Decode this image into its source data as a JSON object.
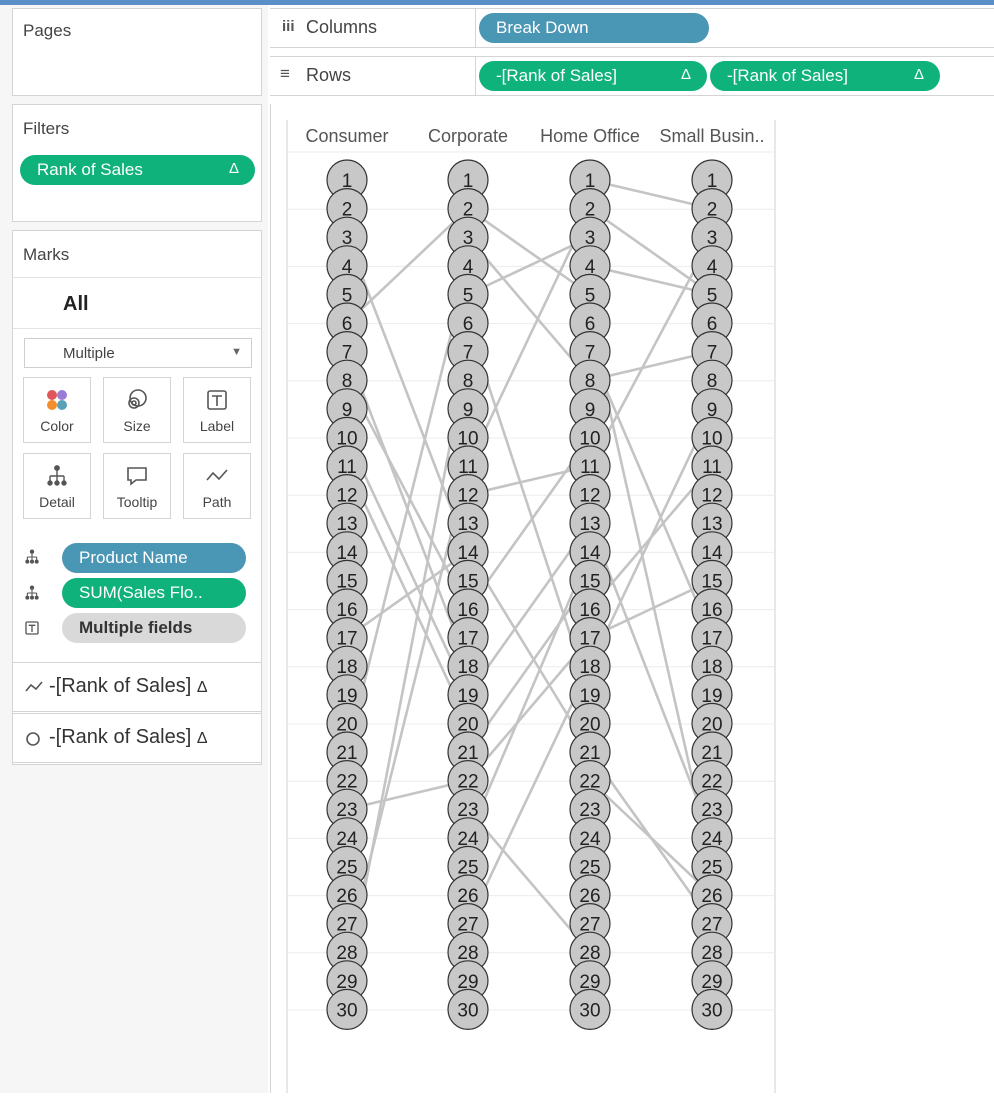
{
  "pages": {
    "title": "Pages"
  },
  "columns": {
    "label": "Columns",
    "pill": "Break Down"
  },
  "rows": {
    "label": "Rows",
    "pills": [
      "-[Rank of Sales]",
      "-[Rank of Sales]"
    ],
    "delta": "Δ"
  },
  "filters": {
    "title": "Filters",
    "pill": "Rank of Sales",
    "delta": "Δ"
  },
  "marks": {
    "title": "Marks",
    "all_label": "All",
    "mark_type": "Multiple",
    "buttons": [
      {
        "label": "Color",
        "icon": "color-icon"
      },
      {
        "label": "Size",
        "icon": "size-icon"
      },
      {
        "label": "Label",
        "icon": "label-icon"
      },
      {
        "label": "Detail",
        "icon": "detail-icon"
      },
      {
        "label": "Tooltip",
        "icon": "tooltip-icon"
      },
      {
        "label": "Path",
        "icon": "path-icon"
      }
    ],
    "fields": [
      {
        "label": "Product Name",
        "icon": "detail-icon"
      },
      {
        "label": "SUM(Sales Flo..",
        "icon": "detail-icon"
      },
      {
        "label": "Multiple fields",
        "icon": "label-icon"
      }
    ],
    "layers": [
      {
        "label": "-[Rank of Sales]",
        "icon": "line-mark-icon",
        "delta": "Δ"
      },
      {
        "label": "-[Rank of Sales]",
        "icon": "circle-mark-icon",
        "delta": "Δ"
      }
    ]
  },
  "colors": {
    "green": "#0fb27a",
    "blue": "#4a96b5",
    "node_fill": "#c8c8c8",
    "line": "#c4c4c4"
  },
  "chart_data": {
    "type": "bump",
    "categories": [
      "Consumer",
      "Corporate",
      "Home Office",
      "Small Busin.."
    ],
    "ranks": [
      1,
      2,
      3,
      4,
      5,
      6,
      7,
      8,
      9,
      10,
      11,
      12,
      13,
      14,
      15,
      16,
      17,
      18,
      19,
      20,
      21,
      22,
      23,
      24,
      25,
      26,
      27,
      28,
      29,
      30
    ],
    "y_reversed": true,
    "connections": [
      {
        "segment": "Consumer-Corporate",
        "from_rank": 6,
        "to_rank": 2
      },
      {
        "segment": "Consumer-Corporate",
        "from_rank": 3,
        "to_rank": 14
      },
      {
        "segment": "Consumer-Corporate",
        "from_rank": 7,
        "to_rank": 18
      },
      {
        "segment": "Consumer-Corporate",
        "from_rank": 8,
        "to_rank": 16
      },
      {
        "segment": "Consumer-Corporate",
        "from_rank": 10,
        "to_rank": 19
      },
      {
        "segment": "Consumer-Corporate",
        "from_rank": 11,
        "to_rank": 20
      },
      {
        "segment": "Consumer-Corporate",
        "from_rank": 17,
        "to_rank": 14
      },
      {
        "segment": "Consumer-Corporate",
        "from_rank": 21,
        "to_rank": 4
      },
      {
        "segment": "Consumer-Corporate",
        "from_rank": 23,
        "to_rank": 22
      },
      {
        "segment": "Consumer-Corporate",
        "from_rank": 28,
        "to_rank": 11
      },
      {
        "segment": "Consumer-Corporate",
        "from_rank": 29,
        "to_rank": 7
      },
      {
        "segment": "Corporate-Home Office",
        "from_rank": 2,
        "to_rank": 5
      },
      {
        "segment": "Corporate-Home Office",
        "from_rank": 3,
        "to_rank": 8
      },
      {
        "segment": "Corporate-Home Office",
        "from_rank": 5,
        "to_rank": 3
      },
      {
        "segment": "Corporate-Home Office",
        "from_rank": 6,
        "to_rank": 19
      },
      {
        "segment": "Corporate-Home Office",
        "from_rank": 11,
        "to_rank": 2
      },
      {
        "segment": "Corporate-Home Office",
        "from_rank": 12,
        "to_rank": 11
      },
      {
        "segment": "Corporate-Home Office",
        "from_rank": 14,
        "to_rank": 21
      },
      {
        "segment": "Corporate-Home Office",
        "from_rank": 16,
        "to_rank": 10
      },
      {
        "segment": "Corporate-Home Office",
        "from_rank": 19,
        "to_rank": 13
      },
      {
        "segment": "Corporate-Home Office",
        "from_rank": 21,
        "to_rank": 15
      },
      {
        "segment": "Corporate-Home Office",
        "from_rank": 22,
        "to_rank": 17
      },
      {
        "segment": "Corporate-Home Office",
        "from_rank": 23,
        "to_rank": 28
      },
      {
        "segment": "Corporate-Home Office",
        "from_rank": 24,
        "to_rank": 14
      },
      {
        "segment": "Corporate-Home Office",
        "from_rank": 27,
        "to_rank": 18
      },
      {
        "segment": "Home Office-Small Busin..",
        "from_rank": 1,
        "to_rank": 2
      },
      {
        "segment": "Home Office-Small Busin..",
        "from_rank": 2,
        "to_rank": 5
      },
      {
        "segment": "Home Office-Small Busin..",
        "from_rank": 4,
        "to_rank": 5
      },
      {
        "segment": "Home Office-Small Busin..",
        "from_rank": 6,
        "to_rank": 25
      },
      {
        "segment": "Home Office-Small Busin..",
        "from_rank": 7,
        "to_rank": 17
      },
      {
        "segment": "Home Office-Small Busin..",
        "from_rank": 8,
        "to_rank": 7
      },
      {
        "segment": "Home Office-Small Busin..",
        "from_rank": 11,
        "to_rank": 3
      },
      {
        "segment": "Home Office-Small Busin..",
        "from_rank": 13,
        "to_rank": 24
      },
      {
        "segment": "Home Office-Small Busin..",
        "from_rank": 16,
        "to_rank": 11
      },
      {
        "segment": "Home Office-Small Busin..",
        "from_rank": 17,
        "to_rank": 15
      },
      {
        "segment": "Home Office-Small Busin..",
        "from_rank": 18,
        "to_rank": 9
      },
      {
        "segment": "Home Office-Small Busin..",
        "from_rank": 21,
        "to_rank": 27
      },
      {
        "segment": "Home Office-Small Busin..",
        "from_rank": 22,
        "to_rank": 26
      }
    ]
  }
}
